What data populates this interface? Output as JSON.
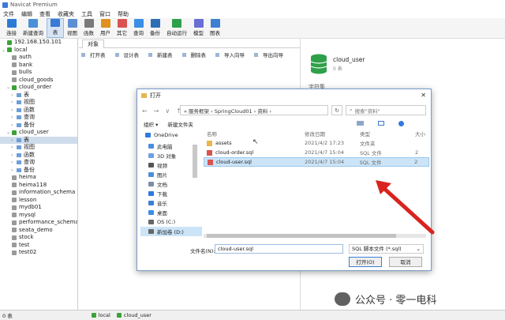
{
  "window": {
    "title": "Navicat Premium"
  },
  "menu": [
    "文件",
    "编辑",
    "查看",
    "收藏夹",
    "工具",
    "窗口",
    "帮助"
  ],
  "toolbar": [
    {
      "label": "连接",
      "icon": "connect-icon",
      "color": "#2d7ad6"
    },
    {
      "label": "新建查询",
      "icon": "new-query-icon",
      "color": "#4a90d9"
    },
    {
      "label": "表",
      "icon": "table-icon",
      "color": "#3a7bd5",
      "active": true
    },
    {
      "label": "视图",
      "icon": "view-icon",
      "color": "#5b8fd4"
    },
    {
      "label": "函数",
      "icon": "function-icon",
      "color": "#7a7a7a"
    },
    {
      "label": "用户",
      "icon": "user-icon",
      "color": "#e0901c"
    },
    {
      "label": "其它",
      "icon": "other-icon",
      "color": "#d9534f"
    },
    {
      "label": "查询",
      "icon": "query-icon",
      "color": "#3a8ee6"
    },
    {
      "label": "备份",
      "icon": "backup-icon",
      "color": "#2f6db5"
    },
    {
      "label": "自动运行",
      "icon": "autorun-icon",
      "color": "#2fa04a"
    },
    {
      "label": "模型",
      "icon": "model-icon",
      "color": "#6a6fd6"
    },
    {
      "label": "图表",
      "icon": "chart-icon",
      "color": "#3f7fd1"
    }
  ],
  "sidebar": {
    "items": [
      {
        "label": "192.168.150.101",
        "kind": "server",
        "depth": 0
      },
      {
        "label": "local",
        "kind": "server",
        "depth": 0,
        "expanded": true
      },
      {
        "label": "auth",
        "kind": "db-off",
        "depth": 1
      },
      {
        "label": "bank",
        "kind": "db-off",
        "depth": 1
      },
      {
        "label": "bulls",
        "kind": "db-off",
        "depth": 1
      },
      {
        "label": "cloud_goods",
        "kind": "db-off",
        "depth": 1
      },
      {
        "label": "cloud_order",
        "kind": "db-on",
        "depth": 1,
        "expanded": true
      },
      {
        "label": "表",
        "kind": "node",
        "depth": 2
      },
      {
        "label": "视图",
        "kind": "node",
        "depth": 2
      },
      {
        "label": "函数",
        "kind": "node",
        "depth": 2
      },
      {
        "label": "查询",
        "kind": "node",
        "depth": 2
      },
      {
        "label": "备份",
        "kind": "node",
        "depth": 2
      },
      {
        "label": "cloud_user",
        "kind": "db-on",
        "depth": 1,
        "expanded": true
      },
      {
        "label": "表",
        "kind": "node",
        "depth": 2,
        "selected": true
      },
      {
        "label": "视图",
        "kind": "node",
        "depth": 2
      },
      {
        "label": "函数",
        "kind": "node",
        "depth": 2
      },
      {
        "label": "查询",
        "kind": "node",
        "depth": 2
      },
      {
        "label": "备份",
        "kind": "node",
        "depth": 2
      },
      {
        "label": "heima",
        "kind": "db-off",
        "depth": 1
      },
      {
        "label": "heima118",
        "kind": "db-off",
        "depth": 1
      },
      {
        "label": "information_schema",
        "kind": "db-off",
        "depth": 1
      },
      {
        "label": "lesson",
        "kind": "db-off",
        "depth": 1
      },
      {
        "label": "mydb01",
        "kind": "db-off",
        "depth": 1
      },
      {
        "label": "mysql",
        "kind": "db-off",
        "depth": 1
      },
      {
        "label": "performance_schema",
        "kind": "db-off",
        "depth": 1
      },
      {
        "label": "seata_demo",
        "kind": "db-off",
        "depth": 1
      },
      {
        "label": "stock",
        "kind": "db-off",
        "depth": 1
      },
      {
        "label": "test",
        "kind": "db-off",
        "depth": 1
      },
      {
        "label": "test02",
        "kind": "db-off",
        "depth": 1
      }
    ]
  },
  "main": {
    "tab_label": "对象",
    "obj_toolbar": [
      "打开表",
      "设计表",
      "新建表",
      "删除表",
      "导入向导",
      "导出向导"
    ]
  },
  "right_panel": {
    "db_name": "cloud_user",
    "db_sub": "0 表",
    "cut_label": "字符集"
  },
  "statusbar": {
    "count": "0 表",
    "conn": "local",
    "db": "cloud_user"
  },
  "dialog": {
    "title": "打开",
    "close_glyph": "✕",
    "nav_back": "←",
    "nav_forward": "→",
    "nav_dropdown": "∨",
    "nav_up": "↑",
    "breadcrumb": "« 服务框架 › SpringCloud01 › 资料 ›",
    "refresh_glyph": "↻",
    "search_placeholder": "搜索\"资料\"",
    "organize": "组织 ▾",
    "new_folder": "新建文件夹",
    "nav_pane": [
      {
        "label": "OneDrive",
        "color": "#2f7ae0"
      },
      {
        "label": "此电脑",
        "color": "#4a8ee0"
      },
      {
        "label": "3D 对象",
        "color": "#6aa0e6"
      },
      {
        "label": "视频",
        "color": "#555"
      },
      {
        "label": "图片",
        "color": "#4a90d9"
      },
      {
        "label": "文档",
        "color": "#7a8ea8"
      },
      {
        "label": "下载",
        "color": "#2f7ae0"
      },
      {
        "label": "音乐",
        "color": "#3b7fd6"
      },
      {
        "label": "桌面",
        "color": "#3a8ee6"
      },
      {
        "label": "OS (C:)",
        "color": "#666"
      },
      {
        "label": "新加卷 (D:)",
        "color": "#666",
        "selected": true
      }
    ],
    "columns": {
      "name": "名称",
      "date": "修改日期",
      "type": "类型",
      "size": "大小"
    },
    "files": [
      {
        "name": "assets",
        "date": "2021/4/2 17:23",
        "type": "文件夹",
        "size": "",
        "icon": "folder-icon",
        "selected": false
      },
      {
        "name": "cloud-order.sql",
        "date": "2021/4/7 15:04",
        "type": "SQL 文件",
        "size": "2",
        "icon": "sql-file-icon",
        "selected": false
      },
      {
        "name": "cloud-user.sql",
        "date": "2021/4/7 15:04",
        "type": "SQL 文件",
        "size": "2",
        "icon": "sql-file-icon",
        "selected": true
      }
    ],
    "filename_label": "文件名(N):",
    "filename_value": "cloud-user.sql",
    "filetype_value": "SQL 脚本文件 (*.sql)",
    "open_button": "打开(O)",
    "cancel_button": "取消"
  },
  "watermark": {
    "text": "公众号 · 零一电科"
  }
}
